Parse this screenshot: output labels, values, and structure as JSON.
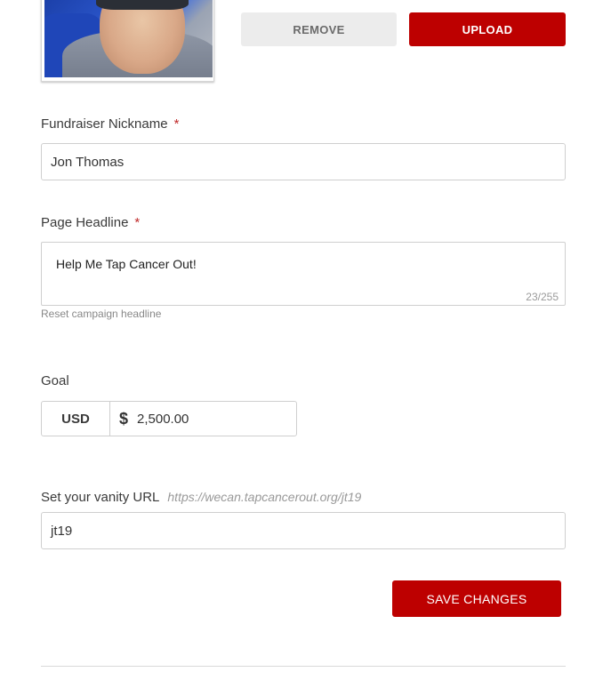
{
  "photo": {
    "buttons": {
      "remove_label": "REMOVE",
      "upload_label": "UPLOAD"
    }
  },
  "fields": {
    "nickname": {
      "label": "Fundraiser Nickname",
      "required_mark": "*",
      "value": "Jon Thomas"
    },
    "headline": {
      "label": "Page Headline",
      "required_mark": "*",
      "value": "Help Me Tap Cancer Out!",
      "counter": "23/255",
      "reset_link": "Reset campaign headline"
    },
    "goal": {
      "label": "Goal",
      "currency": "USD",
      "currency_symbol": "$",
      "amount": "2,500.00"
    },
    "vanity_url": {
      "label": "Set your vanity URL",
      "hint": "https://wecan.tapcancerout.org/jt19",
      "value": "jt19"
    }
  },
  "actions": {
    "save_label": "SAVE CHANGES"
  },
  "colors": {
    "accent": "#bd0000",
    "required": "#c02a2a",
    "border": "#cfcfcf"
  },
  "icons": {
    "currency": "dollar-sign-icon"
  }
}
